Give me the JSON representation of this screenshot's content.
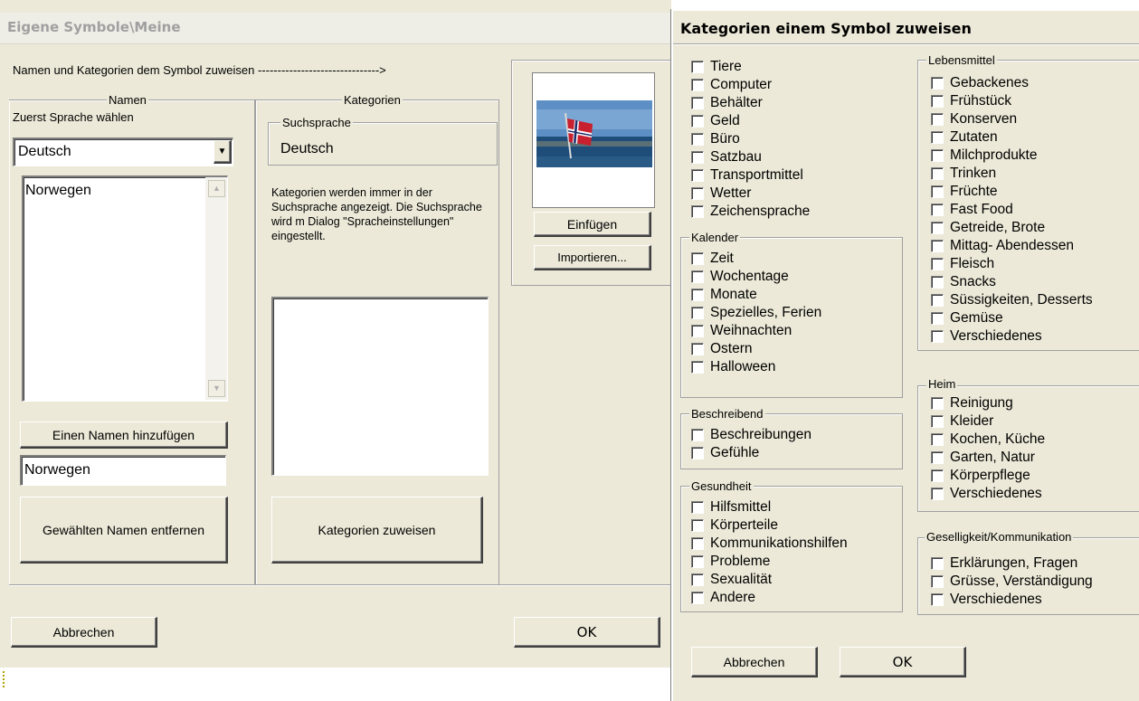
{
  "main_dialog": {
    "title": "Eigene Symbole\\Meine",
    "assign_instruction": "Namen und Kategorien dem Symbol zuweisen ------------------------------->",
    "names_group": "Namen",
    "choose_language_label": "Zuerst Sprache wählen",
    "language_select_value": "Deutsch",
    "names_list": [
      "Norwegen"
    ],
    "add_name_button": "Einen Namen hinzufügen",
    "name_input_value": "Norwegen",
    "remove_name_button": "Gewählten Namen entfernen",
    "categories_group": "Kategorien",
    "search_language_group": "Suchsprache",
    "search_language_value": "Deutsch",
    "categories_info": "Kategorien werden immer in der Suchsprache angezeigt. Die Suchsprache wird m Dialog \"Spracheinstellungen\" eingestellt.",
    "assign_categories_button": "Kategorien zuweisen",
    "insert_button": "Einfügen",
    "import_button": "Importieren...",
    "cancel_button": "Abbrechen",
    "ok_button": "OK"
  },
  "category_dialog": {
    "title": "Kategorien einem Symbol zuweisen",
    "general_items": [
      "Tiere",
      "Computer",
      "Behälter",
      "Geld",
      "Büro",
      "Satzbau",
      "Transportmittel",
      "Wetter",
      "Zeichensprache"
    ],
    "groups": {
      "kalender": {
        "title": "Kalender",
        "items": [
          "Zeit",
          "Wochentage",
          "Monate",
          "Spezielles, Ferien",
          "Weihnachten",
          "Ostern",
          "Halloween"
        ]
      },
      "beschreibend": {
        "title": "Beschreibend",
        "items": [
          "Beschreibungen",
          "Gefühle"
        ]
      },
      "gesundheit": {
        "title": "Gesundheit",
        "items": [
          "Hilfsmittel",
          "Körperteile",
          "Kommunikationshilfen",
          "Probleme",
          "Sexualität",
          "Andere"
        ]
      },
      "lebensmittel": {
        "title": "Lebensmittel",
        "items": [
          "Gebackenes",
          "Frühstück",
          "Konserven",
          "Zutaten",
          "Milchprodukte",
          "Trinken",
          "Früchte",
          "Fast Food",
          "Getreide, Brote",
          "Mittag- Abendessen",
          "Fleisch",
          "Snacks",
          "Süssigkeiten, Desserts",
          "Gemüse",
          "Verschiedenes"
        ]
      },
      "heim": {
        "title": "Heim",
        "items": [
          "Reinigung",
          "Kleider",
          "Kochen, Küche",
          "Garten, Natur",
          "Körperpflege",
          "Verschiedenes"
        ]
      },
      "geselligkeit": {
        "title": "Geselligkeit/Kommunikation",
        "items": [
          "Erklärungen, Fragen",
          "Grüsse, Verständigung",
          "Verschiedenes"
        ]
      }
    },
    "cancel_button": "Abbrechen",
    "ok_button": "OK"
  },
  "colors": {
    "dialog_bg": "#ece9d8",
    "title_bar_bg": "#e8e6da",
    "title_text": "#999999"
  }
}
